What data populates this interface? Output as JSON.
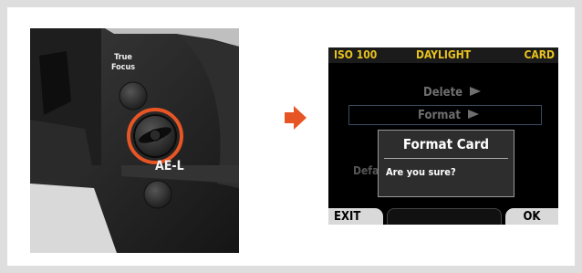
{
  "camera": {
    "true_label": "True",
    "focus_label": "Focus",
    "ae_lock_label": "AE-L"
  },
  "lcd": {
    "iso": "ISO 100",
    "white_balance": "DAYLIGHT",
    "storage": "CARD",
    "menu": {
      "delete_label": "Delete",
      "format_label": "Format",
      "default_label": "Defa"
    },
    "dialog": {
      "title": "Format Card",
      "message": "Are you sure?"
    },
    "softkeys": {
      "exit_label": "EXIT",
      "ok_label": "OK"
    }
  },
  "colors": {
    "accent": "#e85524",
    "lcd_status": "#e8c21e"
  }
}
